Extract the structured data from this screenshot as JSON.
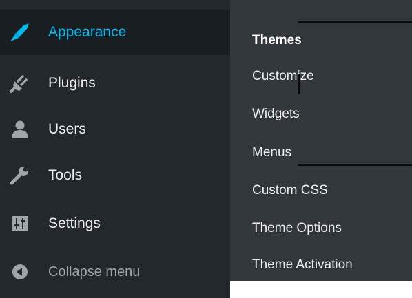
{
  "sidebar": {
    "items": [
      {
        "label": "Appearance",
        "icon": "paintbrush-icon",
        "active": true
      },
      {
        "label": "Plugins",
        "icon": "plug-icon"
      },
      {
        "label": "Users",
        "icon": "users-icon"
      },
      {
        "label": "Tools",
        "icon": "wrench-icon"
      },
      {
        "label": "Settings",
        "icon": "settings-sliders-icon"
      }
    ],
    "collapse": {
      "label": "Collapse menu",
      "icon": "collapse-arrow-icon"
    }
  },
  "submenu": {
    "items": [
      {
        "label": "Themes",
        "current": true
      },
      {
        "label": "Customize"
      },
      {
        "label": "Widgets"
      },
      {
        "label": "Menus"
      },
      {
        "label": "Custom CSS"
      },
      {
        "label": "Theme Options"
      },
      {
        "label": "Theme Activation"
      }
    ]
  },
  "colors": {
    "sidebar_bg": "#23282d",
    "submenu_bg": "#32373c",
    "active_bg": "#191e23",
    "accent": "#00b9eb",
    "text": "#eeeeee",
    "muted_text": "#a0a5aa"
  }
}
